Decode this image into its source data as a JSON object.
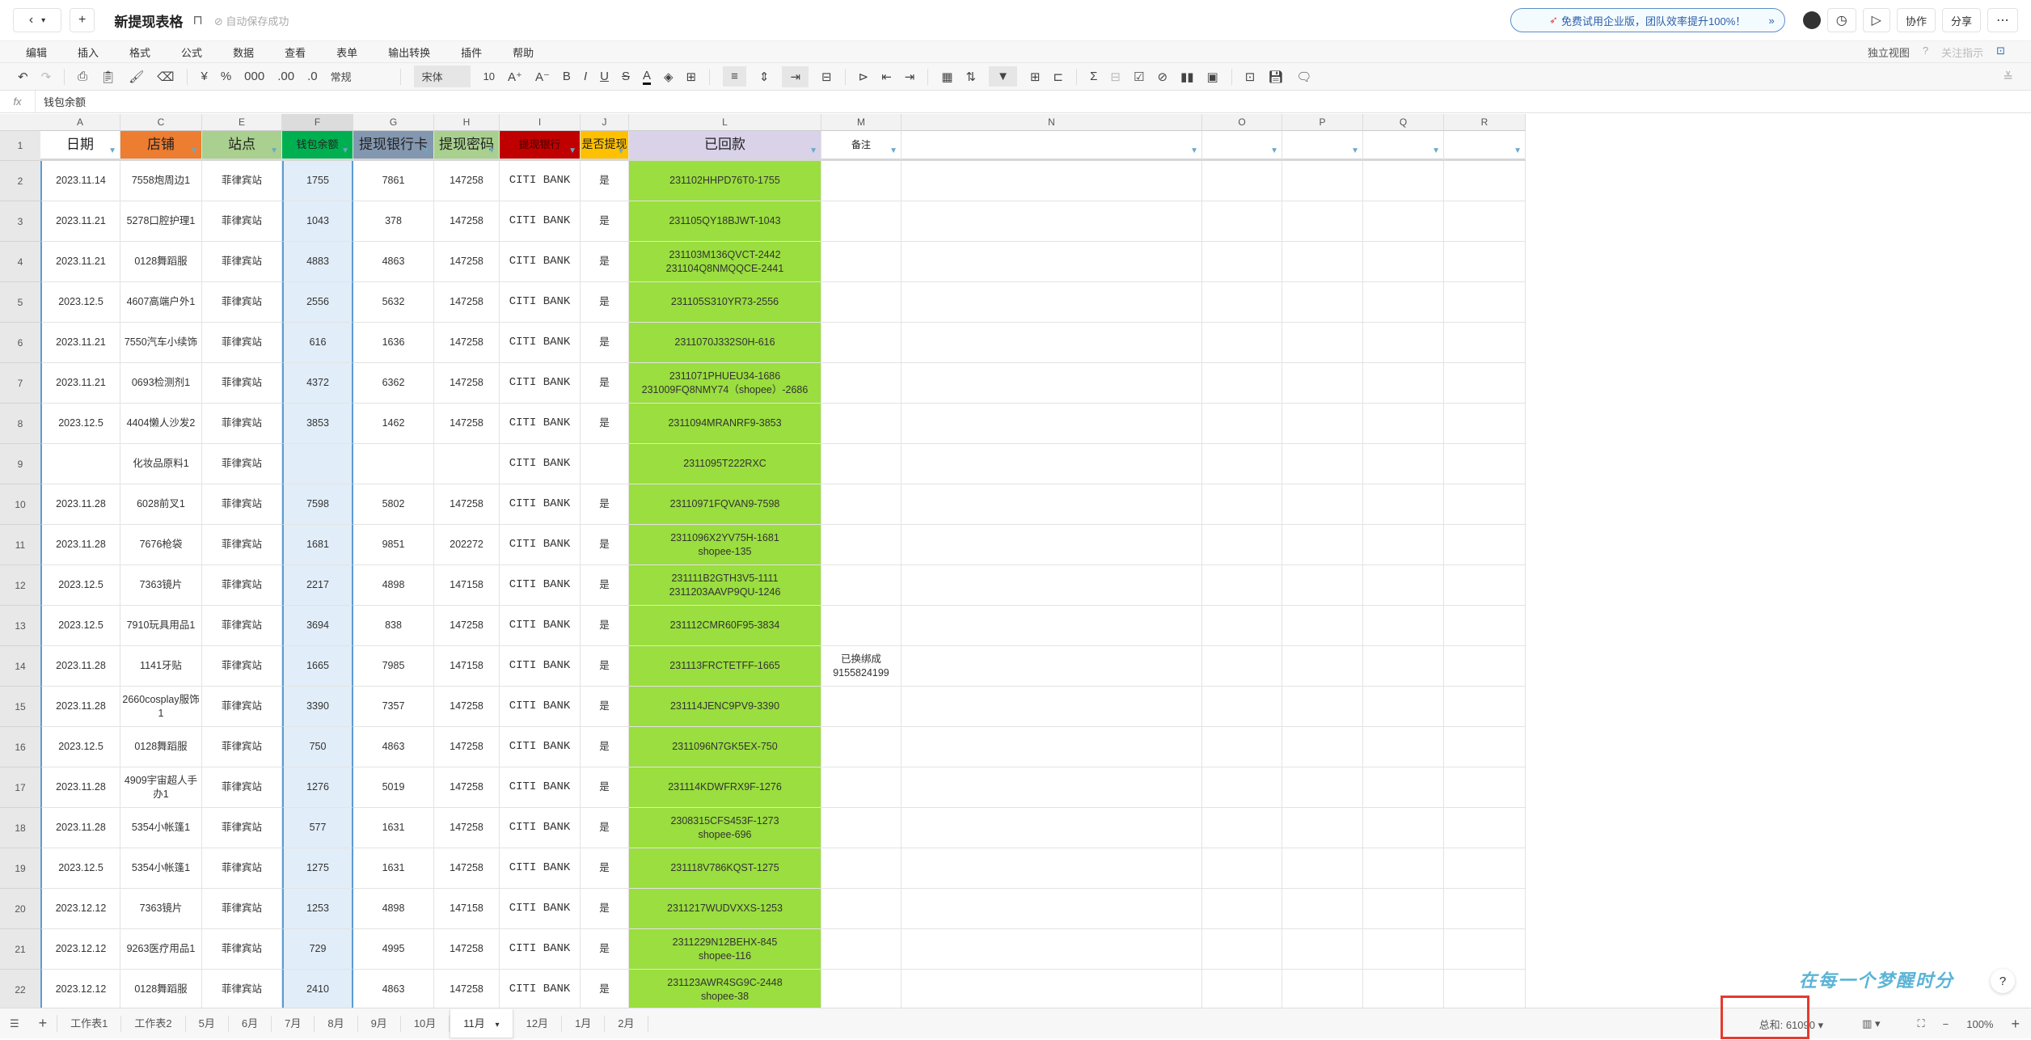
{
  "app": {
    "title": "新提现表格",
    "save_status": "自动保存成功"
  },
  "promo": {
    "text": "免费试用企业版，团队效率提升100%！"
  },
  "top_buttons": {
    "collab": "协作",
    "share": "分享"
  },
  "menu": [
    "编辑",
    "插入",
    "格式",
    "公式",
    "数据",
    "查看",
    "表单",
    "输出转换",
    "插件",
    "帮助"
  ],
  "menu_right": {
    "view": "独立视图",
    "focus": "关注指示"
  },
  "toolbar": {
    "number_format": "常规",
    "font": "宋体",
    "font_size": "10",
    "currency": "¥",
    "percent": "%",
    "thousands": "000"
  },
  "formula_bar": {
    "fx": "fx",
    "value": "钱包余额"
  },
  "columns": [
    "A",
    "C",
    "E",
    "F",
    "G",
    "H",
    "I",
    "J",
    "L",
    "M",
    "N",
    "O",
    "P",
    "Q",
    "R"
  ],
  "headers": [
    "日期",
    "店铺",
    "站点",
    "钱包余额",
    "提现银行卡",
    "提现密码",
    "提现银行",
    "是否提现",
    "已回款",
    "备注",
    "",
    "",
    "",
    "",
    ""
  ],
  "header_colors": [
    "#ffffff",
    "#ED7D31",
    "#A9D08E",
    "#00B050",
    "#8497B0",
    "#A9D08E",
    "#C00000",
    "#FFC000",
    "#D9D2E9",
    "#ffffff",
    "#ffffff",
    "#ffffff",
    "#ffffff",
    "#ffffff",
    "#ffffff"
  ],
  "colors": {
    "paid_column": "#9ADE3F",
    "selected_column": "#E1EDF8",
    "highlight_box": "#E53A2F"
  },
  "rows": [
    [
      "2",
      "2023.11.14",
      "7558炮周边1",
      "菲律宾站",
      "1755",
      "7861",
      "147258",
      "CITI BANK",
      "是",
      "231102HHPD76T0-1755",
      ""
    ],
    [
      "3",
      "2023.11.21",
      "5278口腔护理1",
      "菲律宾站",
      "1043",
      "378",
      "147258",
      "CITI BANK",
      "是",
      "231105QY18BJWT-1043",
      ""
    ],
    [
      "4",
      "2023.11.21",
      "0128舞蹈服",
      "菲律宾站",
      "4883",
      "4863",
      "147258",
      "CITI BANK",
      "是",
      "231103M136QVCT-2442\n231104Q8NMQQCE-2441",
      ""
    ],
    [
      "5",
      "2023.12.5",
      "4607高端户外1",
      "菲律宾站",
      "2556",
      "5632",
      "147258",
      "CITI BANK",
      "是",
      "231105S310YR73-2556",
      ""
    ],
    [
      "6",
      "2023.11.21",
      "7550汽车小续饰",
      "菲律宾站",
      "616",
      "1636",
      "147258",
      "CITI BANK",
      "是",
      "2311070J332S0H-616",
      ""
    ],
    [
      "7",
      "2023.11.21",
      "0693检测剂1",
      "菲律宾站",
      "4372",
      "6362",
      "147258",
      "CITI BANK",
      "是",
      "2311071PHUEU34-1686\n231009FQ8NMY74（shopee）-2686",
      ""
    ],
    [
      "8",
      "2023.12.5",
      "4404懒人沙发2",
      "菲律宾站",
      "3853",
      "1462",
      "147258",
      "CITI BANK",
      "是",
      "2311094MRANRF9-3853",
      ""
    ],
    [
      "9",
      "",
      "化妆品原料1",
      "菲律宾站",
      "",
      "",
      "",
      "CITI BANK",
      "",
      "2311095T222RXC",
      ""
    ],
    [
      "10",
      "2023.11.28",
      "6028前叉1",
      "菲律宾站",
      "7598",
      "5802",
      "147258",
      "CITI BANK",
      "是",
      "23110971FQVAN9-7598",
      ""
    ],
    [
      "11",
      "2023.11.28",
      "7676枪袋",
      "菲律宾站",
      "1681",
      "9851",
      "202272",
      "CITI BANK",
      "是",
      "2311096X2YV75H-1681\nshopee-135",
      ""
    ],
    [
      "12",
      "2023.12.5",
      "7363镜片",
      "菲律宾站",
      "2217",
      "4898",
      "147158",
      "CITI BANK",
      "是",
      "231111B2GTH3V5-1111\n2311203AAVP9QU-1246",
      ""
    ],
    [
      "13",
      "2023.12.5",
      "7910玩具用品1",
      "菲律宾站",
      "3694",
      "838",
      "147258",
      "CITI BANK",
      "是",
      "231112CMR60F95-3834",
      ""
    ],
    [
      "14",
      "2023.11.28",
      "1141牙贴",
      "菲律宾站",
      "1665",
      "7985",
      "147158",
      "CITI BANK",
      "是",
      "231113FRCTETFF-1665",
      "已换绑成\n9155824199"
    ],
    [
      "15",
      "2023.11.28",
      "2660cosplay服饰1",
      "菲律宾站",
      "3390",
      "7357",
      "147258",
      "CITI BANK",
      "是",
      "231114JENC9PV9-3390",
      ""
    ],
    [
      "16",
      "2023.12.5",
      "0128舞蹈服",
      "菲律宾站",
      "750",
      "4863",
      "147258",
      "CITI BANK",
      "是",
      "2311096N7GK5EX-750",
      ""
    ],
    [
      "17",
      "2023.11.28",
      "4909宇宙超人手办1",
      "菲律宾站",
      "1276",
      "5019",
      "147258",
      "CITI BANK",
      "是",
      "231114KDWFRX9F-1276",
      ""
    ],
    [
      "18",
      "2023.11.28",
      "5354小帐篷1",
      "菲律宾站",
      "577",
      "1631",
      "147258",
      "CITI BANK",
      "是",
      "2308315CFS453F-1273\nshopee-696",
      ""
    ],
    [
      "19",
      "2023.12.5",
      "5354小帐篷1",
      "菲律宾站",
      "1275",
      "1631",
      "147258",
      "CITI BANK",
      "是",
      "231118V786KQST-1275",
      ""
    ],
    [
      "20",
      "2023.12.12",
      "7363镜片",
      "菲律宾站",
      "1253",
      "4898",
      "147158",
      "CITI BANK",
      "是",
      "2311217WUDVXXS-1253",
      ""
    ],
    [
      "21",
      "2023.12.12",
      "9263医疗用品1",
      "菲律宾站",
      "729",
      "4995",
      "147258",
      "CITI BANK",
      "是",
      "2311229N12BEHX-845\nshopee-116",
      ""
    ],
    [
      "22",
      "2023.12.12",
      "0128舞蹈服",
      "菲律宾站",
      "2410",
      "4863",
      "147258",
      "CITI BANK",
      "是",
      "231123AWR4SG9C-2448\nshopee-38",
      ""
    ]
  ],
  "sheet_tabs": [
    "工作表1",
    "工作表2",
    "5月",
    "6月",
    "7月",
    "8月",
    "9月",
    "10月",
    "11月",
    "12月",
    "1月",
    "2月"
  ],
  "active_sheet": "11月",
  "status": {
    "sum": "总和: 61090",
    "zoom": "100%"
  },
  "watermark": "在每一个梦醒时分"
}
